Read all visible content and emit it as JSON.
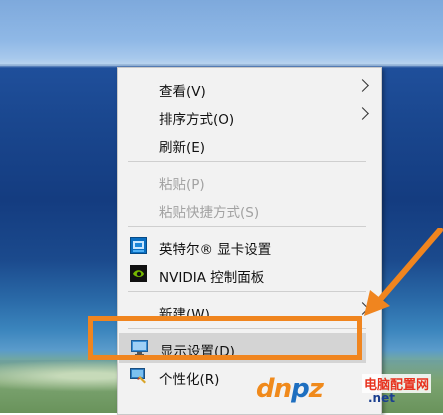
{
  "context_menu": {
    "items": [
      {
        "label": "查看(V)",
        "has_submenu": true,
        "enabled": true
      },
      {
        "label": "排序方式(O)",
        "has_submenu": true,
        "enabled": true
      },
      {
        "label": "刷新(E)",
        "has_submenu": false,
        "enabled": true
      },
      {
        "label": "粘贴(P)",
        "has_submenu": false,
        "enabled": false
      },
      {
        "label": "粘贴快捷方式(S)",
        "has_submenu": false,
        "enabled": false
      },
      {
        "label": "英特尔® 显卡设置",
        "icon": "intel-graphics-icon",
        "has_submenu": false,
        "enabled": true
      },
      {
        "label": "NVIDIA 控制面板",
        "icon": "nvidia-icon",
        "has_submenu": false,
        "enabled": true
      },
      {
        "label": "新建(W)",
        "has_submenu": true,
        "enabled": true
      },
      {
        "label": "显示设置(D)",
        "icon": "display-settings-icon",
        "has_submenu": false,
        "enabled": true,
        "highlighted": true
      },
      {
        "label": "个性化(R)",
        "icon": "personalize-icon",
        "has_submenu": false,
        "enabled": true
      }
    ]
  },
  "annotation": {
    "color": "#f0851f"
  },
  "watermark": {
    "logo_a": "dn",
    "logo_b": "p",
    "logo_c": "z",
    "cn_text": "电脑配置网",
    "domain": ".net"
  }
}
